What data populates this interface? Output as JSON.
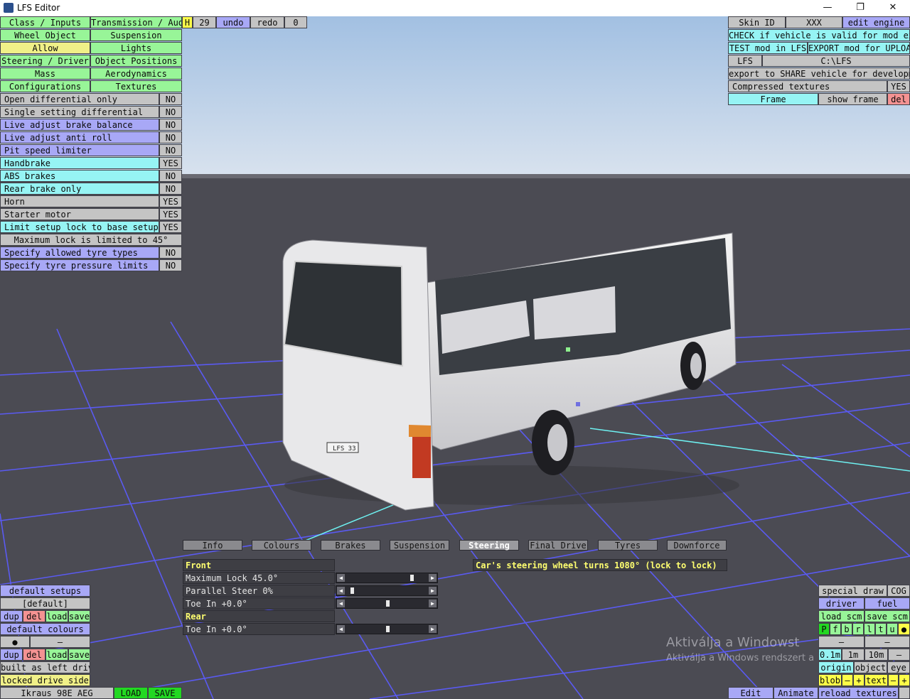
{
  "window": {
    "title": "LFS Editor",
    "min": "—",
    "max": "❐",
    "close": "✕"
  },
  "sections_left": [
    "Class / Inputs",
    "Wheel Object",
    "Allow",
    "Steering / Driver",
    "Mass",
    "Configurations"
  ],
  "sections_right": [
    "Transmission / Audio",
    "Suspension",
    "Lights",
    "Object Positions",
    "Aerodynamics",
    "Textures"
  ],
  "toolbar": {
    "h": "H",
    "count": "29",
    "undo": "undo",
    "redo": "redo",
    "zero": "0"
  },
  "allow_options": [
    {
      "label": "Open differential only",
      "value": "NO"
    },
    {
      "label": "Single setting differential",
      "value": "NO"
    },
    {
      "label": "Live adjust brake balance",
      "value": "NO"
    },
    {
      "label": "Live adjust anti roll",
      "value": "NO"
    },
    {
      "label": "Pit speed limiter",
      "value": "NO"
    },
    {
      "label": "Handbrake",
      "value": "YES"
    },
    {
      "label": "ABS brakes",
      "value": "NO"
    },
    {
      "label": "Rear brake only",
      "value": "NO"
    },
    {
      "label": "Horn",
      "value": "YES"
    },
    {
      "label": "Starter motor",
      "value": "YES"
    },
    {
      "label": "Limit setup lock to base setup lock",
      "value": "YES"
    }
  ],
  "max_lock_note": "Maximum lock is limited to 45°",
  "tyre_options": [
    {
      "label": "Specify allowed tyre types",
      "value": "NO"
    },
    {
      "label": "Specify tyre pressure limits",
      "value": "NO"
    }
  ],
  "top_right": {
    "skin_id": "Skin ID",
    "skin_value": "XXX",
    "edit_engine": "edit engine",
    "check_valid": "CHECK if vehicle is valid for mod export",
    "test_mod": "TEST mod in LFS",
    "export_upload": "EXPORT mod for UPLOAD",
    "lfs": "LFS",
    "lfs_path": "C:\\LFS",
    "export_share": "export to SHARE vehicle for development",
    "compressed": "Compressed textures",
    "compressed_value": "YES",
    "frame": "Frame",
    "show_frame": "show frame",
    "del": "del"
  },
  "tabs": [
    "Info",
    "Colours",
    "Brakes",
    "Suspension",
    "Steering",
    "Final Drive",
    "Tyres",
    "Downforce"
  ],
  "steering": {
    "front": "Front",
    "max_lock": "Maximum Lock 45.0°",
    "parallel": "Parallel Steer 0%",
    "toe_front": "Toe In +0.0°",
    "rear": "Rear",
    "toe_rear": "Toe In +0.0°",
    "info": "Car's steering wheel turns 1080° (lock to lock)",
    "max_lock_fraction": 0.8,
    "parallel_fraction": 0.05,
    "toe_front_fraction": 0.5,
    "toe_rear_fraction": 0.5
  },
  "bottom_left": {
    "default_setups": "default setups",
    "default_tag": "[default]",
    "dup": "dup",
    "del": "del",
    "load": "load",
    "save": "save",
    "default_colours": "default colours",
    "dot": "●",
    "dash": "–",
    "built_left": "built as left drive",
    "locked_side": "locked drive side",
    "vehicle": "Ikraus 98E AEG",
    "load_btn": "LOAD",
    "save_btn": "SAVE"
  },
  "bottom_right": {
    "special_draw": "special draw",
    "cog": "COG",
    "driver": "driver",
    "fuel": "fuel",
    "load_scm": "load scm",
    "save_scm": "save scm",
    "letters": [
      "P",
      "f",
      "b",
      "r",
      "l",
      "t",
      "u",
      "●"
    ],
    "dash": "–",
    "d01": "0.1m",
    "d1": "1m",
    "d10": "10m",
    "origin": "origin",
    "object": "object",
    "eye": "eye",
    "blob": "blob",
    "minus": "–",
    "plus": "+",
    "text": "text",
    "edit": "Edit",
    "animate": "Animate",
    "reload": "reload textures"
  },
  "plate": "LFS 33",
  "watermark": {
    "line1": "Aktiválja a Windowst",
    "line2": "Aktiválja a Windows rendszert a"
  },
  "colors": {
    "green": "#98f598",
    "yellow": "#f0f088",
    "grey": "#c4c4c4",
    "blue": "#a8a8f6",
    "cyan": "#96f4f4",
    "red": "#f49292"
  }
}
